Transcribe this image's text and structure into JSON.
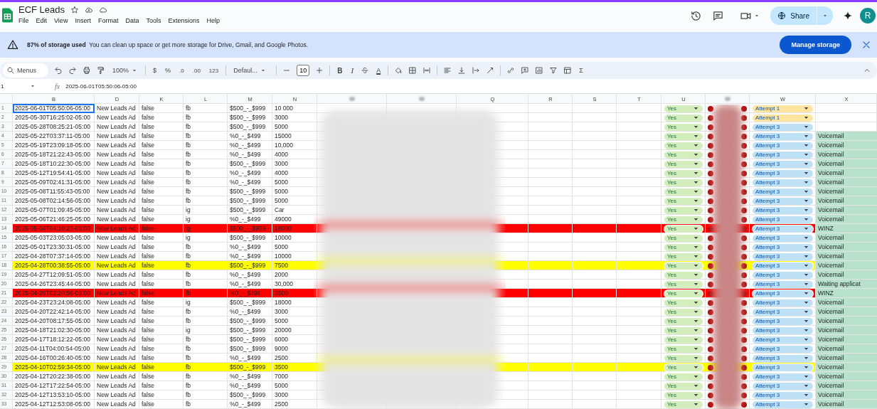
{
  "title": "ECF Leads",
  "menu": [
    "File",
    "Edit",
    "View",
    "Insert",
    "Format",
    "Data",
    "Tools",
    "Extensions",
    "Help"
  ],
  "share": "Share",
  "avatar": "R",
  "banner": {
    "bold": "87% of storage used",
    "text": "You can clean up space or get more storage for Drive, Gmail, and Google Photos.",
    "button": "Manage storage"
  },
  "toolbar": {
    "search_placeholder": "Menus",
    "zoom": "100%",
    "currency": "$",
    "percent": "%",
    "decrease_decimals": ".0",
    "increase_decimals": ".00",
    "number_format": "123",
    "font": "Defaul...",
    "font_size": "10",
    "bold": "B",
    "italic": "I",
    "text_color": "A",
    "functions": "Σ"
  },
  "formula_bar": {
    "cell": "1",
    "fx": "fx",
    "value": "2025-06-01T05:50:06-05:00"
  },
  "columns": [
    {
      "label": "B"
    },
    {
      "label": "D"
    },
    {
      "label": "K"
    },
    {
      "label": "L"
    },
    {
      "label": "M"
    },
    {
      "label": "N"
    },
    {
      "kind": "hidden"
    },
    {
      "kind": "hidden"
    },
    {
      "label": "Q"
    },
    {
      "label": "R"
    },
    {
      "label": "S"
    },
    {
      "label": "T"
    },
    {
      "label": "U"
    },
    {
      "kind": "hidden"
    },
    {
      "label": "W"
    },
    {
      "label": "X"
    }
  ],
  "rows": [
    {
      "row": "1",
      "b": "2025-06-01T05:50:06-05:00",
      "d": "New Leads Ad",
      "k": "false",
      "l": "fb",
      "m": "$500_-_$999",
      "n": "10 000",
      "u": "Yes",
      "w": {
        "label": "Attempt 1",
        "color": "#ffe5a0"
      },
      "selected": true
    },
    {
      "row": "2",
      "b": "2025-05-30T16:25:02-05:00",
      "d": "New Leads Ad",
      "k": "false",
      "l": "fb",
      "m": "$500_-_$999",
      "n": "3000",
      "u": "Yes",
      "w": {
        "label": "Attempt 1",
        "color": "#ffe5a0"
      },
      "selected": false
    },
    {
      "row": "3",
      "b": "2025-05-28T08:25:21-05:00",
      "d": "New Leads Ad",
      "k": "false",
      "l": "fb",
      "m": "$500_-_$999",
      "n": "5000",
      "u": "Yes",
      "w": {
        "label": "Attempt 3",
        "color": "#bfe1f6"
      },
      "selected": false
    },
    {
      "row": "4",
      "b": "2025-05-22T03:37:11-05:00",
      "d": "New Leads Ad",
      "k": "false",
      "l": "fb",
      "m": "%0_-_$499",
      "n": "15000",
      "u": "Yes",
      "w": {
        "label": "Attempt 3",
        "color": "#bfe1f6"
      },
      "x": "Voicemail",
      "selected": false
    },
    {
      "row": "5",
      "b": "2025-05-19T23:09:18-05:00",
      "d": "New Leads Ad",
      "k": "false",
      "l": "fb",
      "m": "%0_-_$499",
      "n": "10,000",
      "u": "Yes",
      "w": {
        "label": "Attempt 3",
        "color": "#bfe1f6"
      },
      "x": "Voicemail",
      "selected": false
    },
    {
      "row": "6",
      "b": "2025-05-18T21:22:43-05:00",
      "d": "New Leads Ad",
      "k": "false",
      "l": "fb",
      "m": "%0_-_$499",
      "n": "4000",
      "u": "Yes",
      "w": {
        "label": "Attempt 3",
        "color": "#bfe1f6"
      },
      "x": "Voicemail",
      "selected": false
    },
    {
      "row": "7",
      "b": "2025-05-18T10:22:30-05:00",
      "d": "New Leads Ad",
      "k": "false",
      "l": "fb",
      "m": "$500_-_$999",
      "n": "3000",
      "u": "Yes",
      "w": {
        "label": "Attempt 3",
        "color": "#bfe1f6"
      },
      "x": "Voicemail",
      "selected": false
    },
    {
      "row": "8",
      "b": "2025-05-12T19:54:41-05:00",
      "d": "New Leads Ad",
      "k": "false",
      "l": "fb",
      "m": "%0_-_$499",
      "n": "4000",
      "u": "Yes",
      "w": {
        "label": "Attempt 3",
        "color": "#bfe1f6"
      },
      "x": "Voicemail",
      "selected": false
    },
    {
      "row": "9",
      "b": "2025-05-09T02:41:31-05:00",
      "d": "New Leads Ad",
      "k": "false",
      "l": "fb",
      "m": "%0_-_$499",
      "n": "5000",
      "u": "Yes",
      "w": {
        "label": "Attempt 3",
        "color": "#bfe1f6"
      },
      "x": "Voicemail",
      "selected": false
    },
    {
      "row": "10",
      "b": "2025-05-08T11:55:43-05:00",
      "d": "New Leads Ad",
      "k": "false",
      "l": "fb",
      "m": "$500_-_$999",
      "n": "5000",
      "u": "Yes",
      "w": {
        "label": "Attempt 3",
        "color": "#bfe1f6"
      },
      "x": "Voicemail",
      "selected": false
    },
    {
      "row": "11",
      "b": "2025-05-08T02:14:56-05:00",
      "d": "New Leads Ad",
      "k": "false",
      "l": "fb",
      "m": "$500_-_$999",
      "n": "5000",
      "u": "Yes",
      "w": {
        "label": "Attempt 3",
        "color": "#bfe1f6"
      },
      "x": "Voicemail",
      "selected": false
    },
    {
      "row": "12",
      "b": "2025-05-07T01:09:45-05:00",
      "d": "New Leads Ad",
      "k": "false",
      "l": "ig",
      "m": "$500_-_$999",
      "n": "Car",
      "u": "Yes",
      "w": {
        "label": "Attempt 3",
        "color": "#bfe1f6"
      },
      "x": "Voicemail",
      "selected": false
    },
    {
      "row": "13",
      "b": "2025-05-06T21:46:25-05:00",
      "d": "New Leads Ad",
      "k": "false",
      "l": "ig",
      "m": "%0_-_$499",
      "n": "49000",
      "u": "Yes",
      "w": {
        "label": "Attempt 3",
        "color": "#bfe1f6"
      },
      "x": "Voicemail",
      "selected": false
    },
    {
      "row": "14",
      "b": "2025-05-04T04:10:23-05:00",
      "d": "New Leads Ad",
      "k": "false",
      "l": "ig",
      "m": "$500_-_$999",
      "n": "18000",
      "u": "Yes",
      "w": {
        "label": "Attempt 3",
        "color": "#bfe1f6"
      },
      "x": "WINZ",
      "color": "#ff0000",
      "selected": false
    },
    {
      "row": "15",
      "b": "2025-05-03T23:05:03-05:00",
      "d": "New Leads Ad",
      "k": "false",
      "l": "ig",
      "m": "$500_-_$999",
      "n": "10000",
      "u": "Yes",
      "w": {
        "label": "Attempt 3",
        "color": "#bfe1f6"
      },
      "x": "Voicemail",
      "selected": false
    },
    {
      "row": "16",
      "b": "2025-05-01T23:30:31-05:00",
      "d": "New Leads Ad",
      "k": "false",
      "l": "fb",
      "m": "%0_-_$499",
      "n": "5000",
      "u": "Yes",
      "w": {
        "label": "Attempt 3",
        "color": "#bfe1f6"
      },
      "x": "Voicemail",
      "selected": false
    },
    {
      "row": "17",
      "b": "2025-04-28T07:37:14-05:00",
      "d": "New Leads Ad",
      "k": "false",
      "l": "fb",
      "m": "%0_-_$499",
      "n": "10000",
      "u": "Yes",
      "w": {
        "label": "Attempt 3",
        "color": "#bfe1f6"
      },
      "x": "Voicemail",
      "selected": false
    },
    {
      "row": "18",
      "b": "2025-04-28T00:38:55-05:00",
      "d": "New Leads Ad",
      "k": "false",
      "l": "fb",
      "m": "$500_-_$999",
      "n": "7500",
      "u": "Yes",
      "w": {
        "label": "Attempt 3",
        "color": "#bfe1f6"
      },
      "x": "Voicemail",
      "color": "#ffff00",
      "selected": false
    },
    {
      "row": "19",
      "b": "2025-04-27T12:09:51-05:00",
      "d": "New Leads Ad",
      "k": "false",
      "l": "fb",
      "m": "%0_-_$499",
      "n": "2000",
      "u": "Yes",
      "w": {
        "label": "Attempt 3",
        "color": "#bfe1f6"
      },
      "x": "Voicemail",
      "selected": false
    },
    {
      "row": "20",
      "b": "2025-04-26T23:45:44-05:00",
      "d": "New Leads Ad",
      "k": "false",
      "l": "fb",
      "m": "%0_-_$499",
      "n": "30,000",
      "u": "Yes",
      "w": {
        "label": "Attempt 3",
        "color": "#bfe1f6"
      },
      "x": "Waiting applicat",
      "selected": false
    },
    {
      "row": "21",
      "b": "2025-04-26T02:20:56-05:00",
      "d": "New Leads Ad",
      "k": "false",
      "l": "fb",
      "m": "%0_-_$499",
      "n": "3500",
      "u": "Yes",
      "w": {
        "label": "Attempt 3",
        "color": "#bfe1f6"
      },
      "x": "WINZ",
      "color": "#ff0000",
      "selected": false
    },
    {
      "row": "22",
      "b": "2025-04-23T23:24:08-05:00",
      "d": "New Leads Ad",
      "k": "false",
      "l": "ig",
      "m": "$500_-_$999",
      "n": "18000",
      "u": "Yes",
      "w": {
        "label": "Attempt 3",
        "color": "#bfe1f6"
      },
      "x": "Voicemail",
      "selected": false
    },
    {
      "row": "23",
      "b": "2025-04-20T22:42:14-05:00",
      "d": "New Leads Ad",
      "k": "false",
      "l": "fb",
      "m": "%0_-_$499",
      "n": "3000",
      "u": "Yes",
      "w": {
        "label": "Attempt 3",
        "color": "#bfe1f6"
      },
      "x": "Voicemail",
      "selected": false
    },
    {
      "row": "24",
      "b": "2025-04-20T08:17:55-05:00",
      "d": "New Leads Ad",
      "k": "false",
      "l": "fb",
      "m": "$500_-_$999",
      "n": "5000",
      "u": "Yes",
      "w": {
        "label": "Attempt 3",
        "color": "#bfe1f6"
      },
      "x": "Voicemail",
      "selected": false
    },
    {
      "row": "25",
      "b": "2025-04-18T21:02:30-05:00",
      "d": "New Leads Ad",
      "k": "false",
      "l": "ig",
      "m": "$500_-_$999",
      "n": "20000",
      "u": "Yes",
      "w": {
        "label": "Attempt 3",
        "color": "#bfe1f6"
      },
      "x": "Voicemail",
      "selected": false
    },
    {
      "row": "26",
      "b": "2025-04-17T18:12:22-05:00",
      "d": "New Leads Ad",
      "k": "false",
      "l": "fb",
      "m": "$500_-_$999",
      "n": "6000",
      "u": "Yes",
      "w": {
        "label": "Attempt 3",
        "color": "#bfe1f6"
      },
      "x": "Voicemail",
      "selected": false
    },
    {
      "row": "27",
      "b": "2025-04-11T04:00:54-05:00",
      "d": "New Leads Ad",
      "k": "false",
      "l": "fb",
      "m": "$500_-_$999",
      "n": "9000",
      "u": "Yes",
      "w": {
        "label": "Attempt 3",
        "color": "#bfe1f6"
      },
      "x": "Voicemail",
      "selected": false
    },
    {
      "row": "28",
      "b": "2025-04-16T00:26:40-05:00",
      "d": "New Leads Ad",
      "k": "false",
      "l": "fb",
      "m": "%0_-_$499",
      "n": "2500",
      "u": "Yes",
      "w": {
        "label": "Attempt 3",
        "color": "#bfe1f6"
      },
      "x": "Voicemail",
      "selected": false
    },
    {
      "row": "29",
      "b": "2025-04-10T02:59:34-05:00",
      "d": "New Leads Ad",
      "k": "false",
      "l": "fb",
      "m": "$500_-_$999",
      "n": "3500",
      "u": "Yes",
      "w": {
        "label": "Attempt 3",
        "color": "#bfe1f6"
      },
      "x": "Voicemail",
      "color": "#ffff00",
      "selected": false
    },
    {
      "row": "30",
      "b": "2025-04-12T20:22:38-05:00",
      "d": "New Leads Ad",
      "k": "false",
      "l": "fb",
      "m": "%0_-_$499",
      "n": "7000",
      "u": "Yes",
      "w": {
        "label": "Attempt 3",
        "color": "#bfe1f6"
      },
      "x": "Voicemail",
      "selected": false
    },
    {
      "row": "31",
      "b": "2025-04-12T17:22:54-05:00",
      "d": "New Leads Ad",
      "k": "false",
      "l": "fb",
      "m": "%0_-_$499",
      "n": "5000",
      "u": "Yes",
      "w": {
        "label": "Attempt 3",
        "color": "#bfe1f6"
      },
      "x": "Voicemail",
      "selected": false
    },
    {
      "row": "32",
      "b": "2025-04-12T13:53:10-05:00",
      "d": "New Leads Ad",
      "k": "false",
      "l": "fb",
      "m": "$500_-_$999",
      "n": "3000",
      "u": "Yes",
      "w": {
        "label": "Attempt 3",
        "color": "#bfe1f6"
      },
      "x": "Voicemail",
      "selected": false
    },
    {
      "row": "33",
      "b": "2025-04-12T12:53:08-05:00",
      "d": "New Leads Ad",
      "k": "false",
      "l": "fb",
      "m": "%0_-_$499",
      "n": "2500",
      "u": "Yes",
      "w": {
        "label": "Attempt 3",
        "color": "#bfe1f6"
      },
      "x": "Voicemail",
      "selected": false
    }
  ]
}
